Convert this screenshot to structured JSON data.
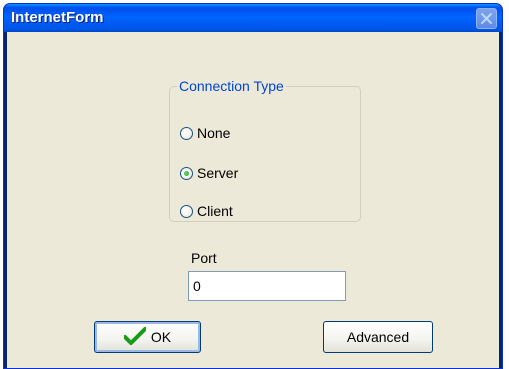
{
  "window": {
    "title": "InternetForm",
    "close_icon": "close-icon"
  },
  "connection_type": {
    "legend": "Connection Type",
    "options": [
      {
        "label": "None",
        "selected": false
      },
      {
        "label": "Server",
        "selected": true
      },
      {
        "label": "Client",
        "selected": false
      }
    ]
  },
  "port": {
    "label": "Port",
    "value": "0"
  },
  "buttons": {
    "ok_label": "OK",
    "ok_icon": "checkmark-icon",
    "advanced_label": "Advanced"
  },
  "colors": {
    "title_bar": "#0058f0",
    "client_bg": "#ece9d8",
    "legend_text": "#0046d5",
    "check_green": "#1a9a1a"
  }
}
